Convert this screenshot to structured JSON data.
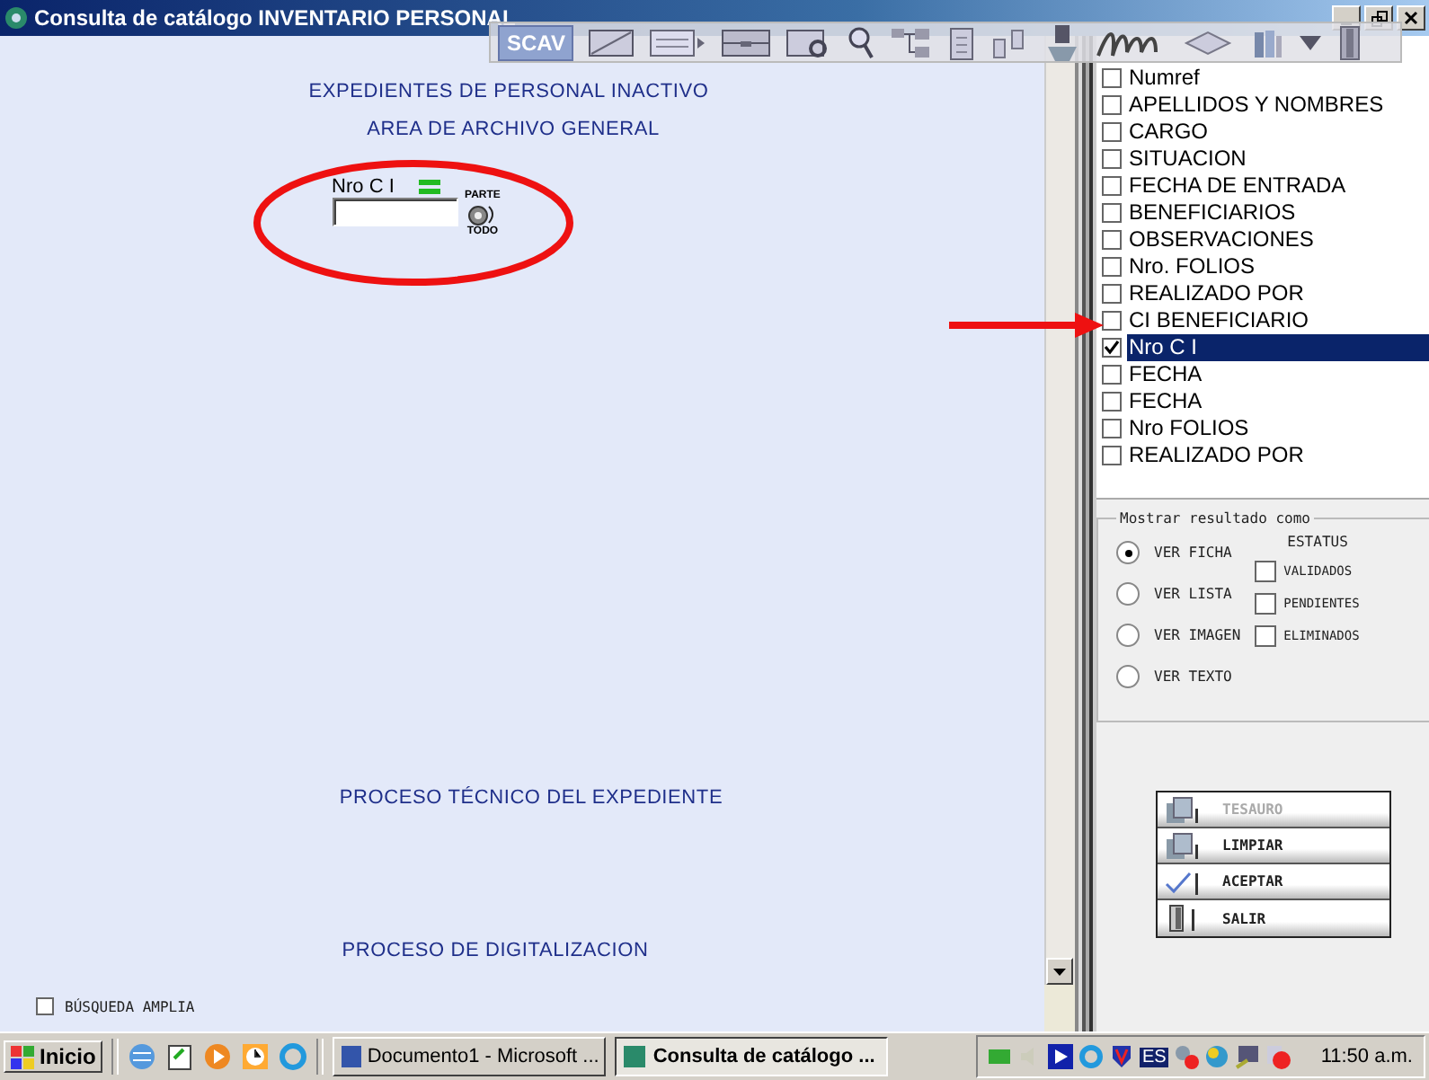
{
  "window": {
    "title": "Consulta de catálogo INVENTARIO PERSONAL"
  },
  "toolbar": {
    "scav_label": "SCAV"
  },
  "form": {
    "heading": "EXPEDIENTES DE PERSONAL INACTIVO",
    "subheading": "AREA DE ARCHIVO GENERAL",
    "field_label": "Nro C I",
    "mode_top": "PARTE",
    "mode_bottom": "TODO",
    "section_1": "PROCESO TÉCNICO DEL EXPEDIENTE",
    "section_2": "PROCESO DE DIGITALIZACION",
    "wide_search": {
      "label": "BÚSQUEDA AMPLIA",
      "checked": false
    }
  },
  "fields": [
    {
      "label": "Numref",
      "checked": false,
      "selected": false
    },
    {
      "label": "APELLIDOS Y NOMBRES",
      "checked": false,
      "selected": false
    },
    {
      "label": "CARGO",
      "checked": false,
      "selected": false
    },
    {
      "label": "SITUACION",
      "checked": false,
      "selected": false
    },
    {
      "label": "FECHA DE ENTRADA",
      "checked": false,
      "selected": false
    },
    {
      "label": "BENEFICIARIOS",
      "checked": false,
      "selected": false
    },
    {
      "label": "OBSERVACIONES",
      "checked": false,
      "selected": false
    },
    {
      "label": "Nro. FOLIOS",
      "checked": false,
      "selected": false
    },
    {
      "label": "REALIZADO POR",
      "checked": false,
      "selected": false
    },
    {
      "label": "CI BENEFICIARIO",
      "checked": false,
      "selected": false
    },
    {
      "label": "Nro C I",
      "checked": true,
      "selected": true
    },
    {
      "label": "FECHA",
      "checked": false,
      "selected": false
    },
    {
      "label": "FECHA",
      "checked": false,
      "selected": false
    },
    {
      "label": "Nro FOLIOS",
      "checked": false,
      "selected": false
    },
    {
      "label": "REALIZADO POR",
      "checked": false,
      "selected": false
    }
  ],
  "result_group": {
    "legend": "Mostrar resultado como",
    "views": [
      {
        "label": "VER FICHA",
        "selected": true
      },
      {
        "label": "VER LISTA",
        "selected": false
      },
      {
        "label": "VER IMAGEN",
        "selected": false
      },
      {
        "label": "VER TEXTO",
        "selected": false
      }
    ],
    "status_title": "ESTATUS",
    "status": [
      {
        "label": "VALIDADOS",
        "checked": false
      },
      {
        "label": "PENDIENTES",
        "checked": false
      },
      {
        "label": "ELIMINADOS",
        "checked": false
      }
    ]
  },
  "actions": [
    {
      "label": "TESAURO",
      "kind": "book",
      "disabled": true
    },
    {
      "label": "LIMPIAR",
      "kind": "book",
      "disabled": false
    },
    {
      "label": "ACEPTAR",
      "kind": "check",
      "disabled": false
    },
    {
      "label": "SALIR",
      "kind": "door",
      "disabled": false
    }
  ],
  "taskbar": {
    "start": "Inicio",
    "tasks": [
      {
        "label": "Documento1 - Microsoft ...",
        "selected": false
      },
      {
        "label": "Consulta de catálogo ...",
        "selected": true
      }
    ],
    "tray_lang": "ES",
    "clock": "11:50 a.m."
  }
}
